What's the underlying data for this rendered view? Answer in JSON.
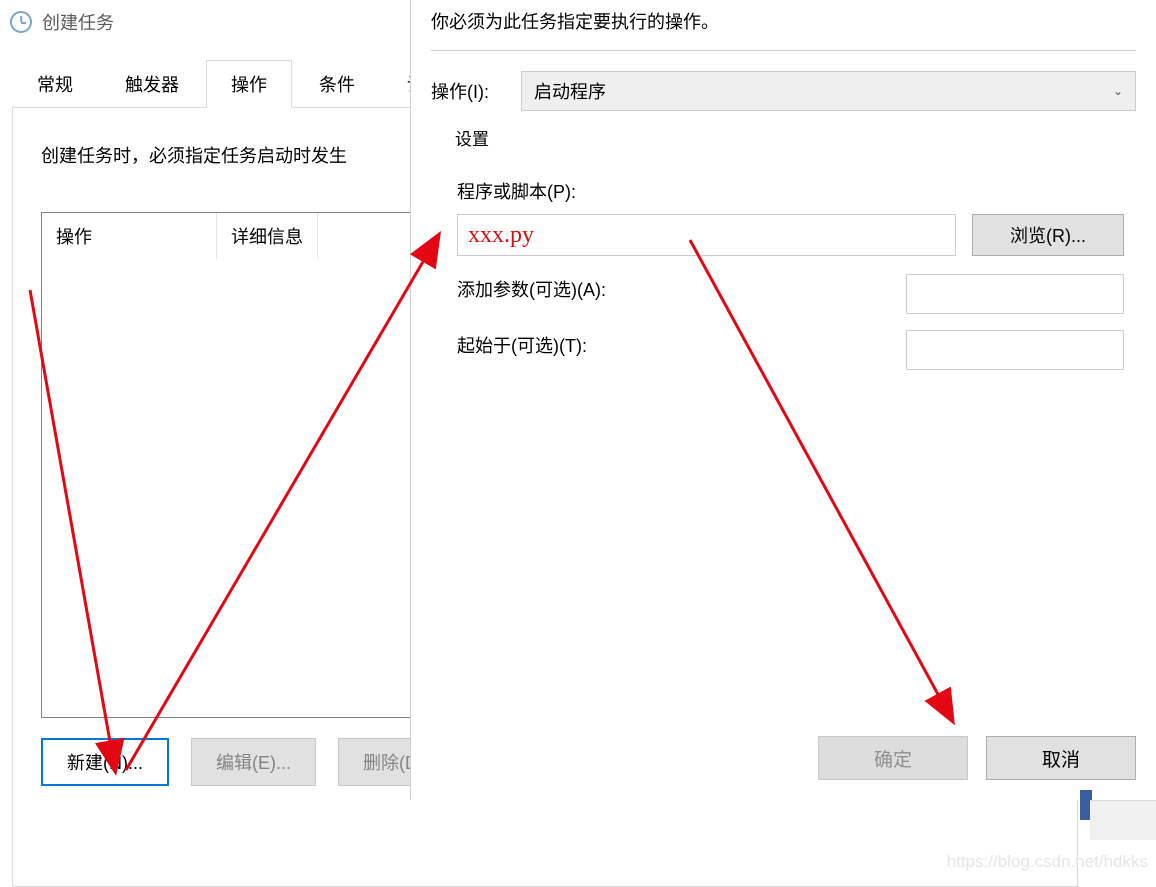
{
  "mainWindow": {
    "title": "创建任务",
    "tabs": [
      "常规",
      "触发器",
      "操作",
      "条件",
      "设置"
    ],
    "activeTab": "操作",
    "tabInstruction": "创建任务时，必须指定任务启动时发生",
    "table": {
      "col1": "操作",
      "col2": "详细信息"
    },
    "buttons": {
      "new": "新建(N)...",
      "edit": "编辑(E)...",
      "delete": "删除(D)"
    }
  },
  "actionDialog": {
    "instruction": "你必须为此任务指定要执行的操作。",
    "actionLabel": "操作(I):",
    "actionSelected": "启动程序",
    "settingsLegend": "设置",
    "programLabel": "程序或脚本(P):",
    "programValue": "xxx.py",
    "browse": "浏览(R)...",
    "argsLabel": "添加参数(可选)(A):",
    "startInLabel": "起始于(可选)(T):",
    "ok": "确定",
    "cancel": "取消"
  },
  "watermark": "https://blog.csdn.net/hdkks"
}
